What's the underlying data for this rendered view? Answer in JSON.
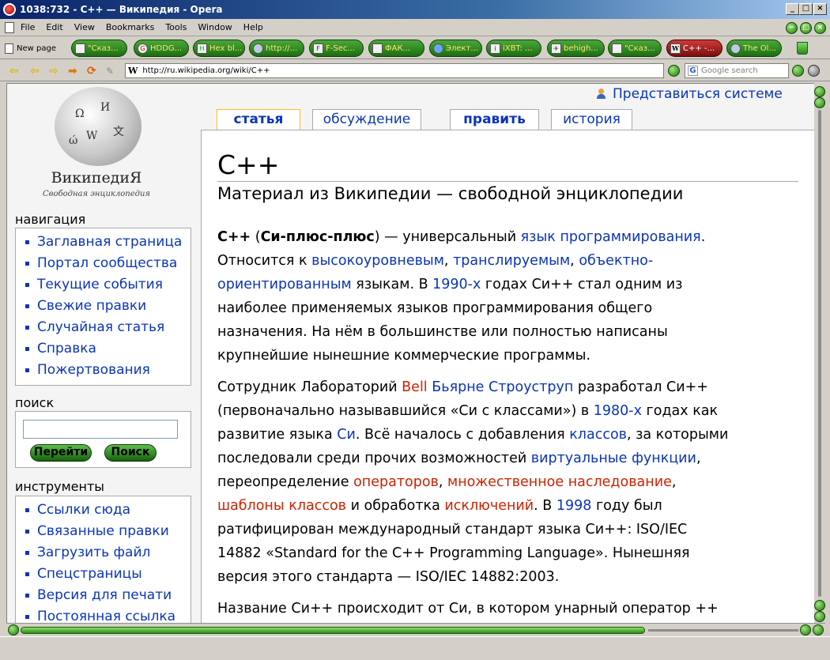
{
  "window": {
    "title": "1038:732 - C++ — Википедия - Opera"
  },
  "menu": [
    "File",
    "Edit",
    "View",
    "Bookmarks",
    "Tools",
    "Window",
    "Help"
  ],
  "tabs": {
    "new_page": "New page",
    "items": [
      {
        "label": "\"Сказ...",
        "icon": "page-icon"
      },
      {
        "label": "HDDG...",
        "icon": "g-icon"
      },
      {
        "label": "Hex bl...",
        "icon": "hex-icon"
      },
      {
        "label": "http://...",
        "icon": "globe-icon"
      },
      {
        "label": "F-Sec...",
        "icon": "f-icon"
      },
      {
        "label": "ФАК...",
        "icon": "page-icon"
      },
      {
        "label": "Элект...",
        "icon": "globe-icon"
      },
      {
        "label": "iXBT: ...",
        "icon": "i-icon"
      },
      {
        "label": "behigh...",
        "icon": "bird-icon"
      },
      {
        "label": "\"Сказ...",
        "icon": "page-icon"
      },
      {
        "label": "C++ -...",
        "icon": "w-icon",
        "active": true
      },
      {
        "label": "The Ol...",
        "icon": "globe-icon"
      }
    ]
  },
  "address": {
    "url": "http://ru.wikipedia.org/wiki/C++",
    "site_icon": "W",
    "search_placeholder": "Google search"
  },
  "logo": {
    "title": "ВикипедиЯ",
    "subtitle": "Свободная энциклопедия"
  },
  "login": "Представиться системе",
  "content_tabs": [
    {
      "label": "статья",
      "selected": true
    },
    {
      "label": "обсуждение"
    },
    {
      "label": "править"
    },
    {
      "label": "история"
    }
  ],
  "sidebar": {
    "navigation": {
      "title": "навигация",
      "items": [
        "Заглавная страница",
        "Портал сообщества",
        "Текущие события",
        "Свежие правки",
        "Случайная статья",
        "Справка",
        "Пожертвования"
      ]
    },
    "search": {
      "title": "поиск",
      "go": "Перейти",
      "search": "Поиск"
    },
    "tools": {
      "title": "инструменты",
      "items": [
        "Ссылки сюда",
        "Связанные правки",
        "Загрузить файл",
        "Спецстраницы",
        "Версия для печати",
        "Постоянная ссылка"
      ]
    }
  },
  "article": {
    "title": "C++",
    "subtitle": "Материал из Википедии — свободной энциклопедии",
    "p1": {
      "b1": "C++",
      "t1": " (",
      "b2": "Си-плюс-плюс",
      "t2": ") — универсальный ",
      "l1": "язык программирования",
      "t3": ".",
      "t4": "Относится к ",
      "l2": "высокоуровневым",
      "t5": ", ",
      "l3": "транслируемым",
      "t6": ", ",
      "l4": "объектно-",
      "l5": "ориентированным",
      "t7": " языкам. В ",
      "l6": "1990-х",
      "t8": " годах Си++ стал одним из",
      "t9": "наиболее применяемых языков программирования общего",
      "t10": "назначения. На нём в большинстве или полностью написаны",
      "t11": "крупнейшие нынешние коммерческие программы."
    },
    "p2": {
      "t1": "Сотрудник Лабораторий ",
      "r1": "Bell",
      "t2": " ",
      "l1": "Бьярне Строуструп",
      "t3": " разработал Си++",
      "t4": "(первоначально называвшийся «Си с классами») в ",
      "l2": "1980-х",
      "t5": " годах как",
      "t6": "развитие языка ",
      "l3": "Си",
      "t7": ". Всё началось с добавления ",
      "l4": "классов",
      "t8": ", за которыми",
      "t9": "последовали среди прочих возможностей ",
      "l5": "виртуальные функции",
      "t10": ",",
      "t11": "переопределение ",
      "r2": "операторов",
      "t12": ", ",
      "r3": "множественное наследование",
      "t13": ",",
      "r4": "шаблоны классов",
      "t14": " и обработка ",
      "r5": "исключений",
      "t15": ". В ",
      "l6": "1998",
      "t16": " году был",
      "t17": "ратифицирован международный стандарт языка Си++: ISO/IEC",
      "t18": "14882 «Standard for the C++ Programming Language». Нынешняя",
      "t19": "версия этого стандарта — ISO/IEC 14882:2003."
    },
    "p3": {
      "t1": "Название Си++ происходит от Си, в котором унарный оператор ++"
    }
  },
  "colors": {
    "link": "#0b35b7",
    "redlink": "#cc2200",
    "opera_green": "#2a8a16"
  }
}
